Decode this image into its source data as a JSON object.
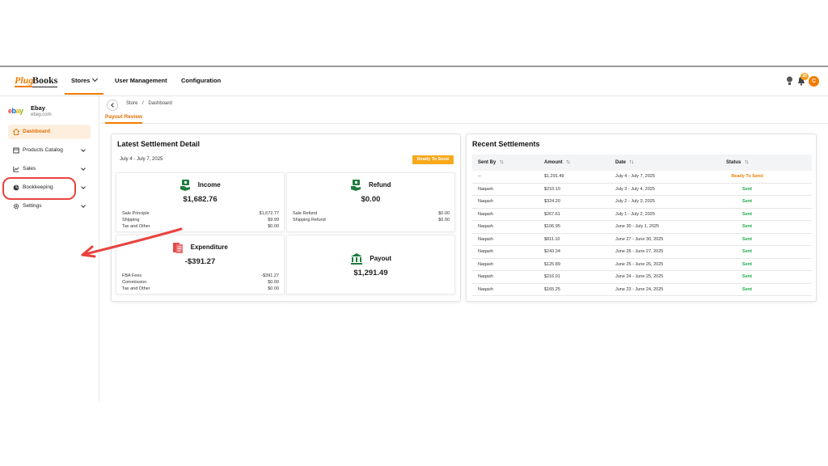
{
  "topnav": {
    "logo_plug": "Plug",
    "logo_books": "Books",
    "items": [
      {
        "label": "Stores"
      },
      {
        "label": "User Management"
      },
      {
        "label": "Configuration"
      }
    ],
    "notification_count": "20",
    "avatar_initial": "C",
    "accent_color": "#f07c00"
  },
  "sidebar": {
    "store_name": "Ebay",
    "store_domain": "ebay.com",
    "items": [
      {
        "label": "Dashboard",
        "icon": "home-icon",
        "active": true
      },
      {
        "label": "Products Catalog",
        "icon": "catalog-icon"
      },
      {
        "label": "Sales",
        "icon": "chart-icon"
      },
      {
        "label": "Bookkeeping",
        "icon": "bookkeeping-icon"
      },
      {
        "label": "Settings",
        "icon": "gear-icon"
      }
    ]
  },
  "breadcrumb": {
    "items": [
      "Store",
      "/",
      "Dashboard"
    ],
    "subtab": "Payout Review"
  },
  "latest": {
    "title": "Latest Settlement Detail",
    "period": "July 4 - July 7, 2025",
    "status_badge": "Ready To Send",
    "income": {
      "title": "Income",
      "amount": "$1,682.76",
      "lines": [
        {
          "label": "Sale Principle",
          "value": "$1,672.77"
        },
        {
          "label": "Shipping",
          "value": "$9.99"
        },
        {
          "label": "Tax and Other",
          "value": "$0.00"
        }
      ]
    },
    "refund": {
      "title": "Refund",
      "amount": "$0.00",
      "lines": [
        {
          "label": "Sale Refund",
          "value": "$0.00"
        },
        {
          "label": "Shipping Refund",
          "value": "$0.00"
        }
      ]
    },
    "expenditure": {
      "title": "Expenditure",
      "amount": "-$391.27",
      "lines": [
        {
          "label": "FBA Fees",
          "value": "-$391.27"
        },
        {
          "label": "Commission",
          "value": "$0.00"
        },
        {
          "label": "Tax and Other",
          "value": "$0.00"
        }
      ]
    },
    "payout": {
      "title": "Payout",
      "amount": "$1,291.49"
    }
  },
  "recent": {
    "title": "Recent Settlements",
    "columns": [
      "Sent By",
      "Amount",
      "Date",
      "Status"
    ],
    "rows": [
      {
        "sent_by": "--",
        "amount": "$1,291.49",
        "date": "July 4 - July 7, 2025",
        "status": "Ready To Send"
      },
      {
        "sent_by": "Naqash",
        "amount": "$210.10",
        "date": "July 3 - July 4, 2025",
        "status": "Sent"
      },
      {
        "sent_by": "Naqash",
        "amount": "$324.20",
        "date": "July 2 - July 3, 2025",
        "status": "Sent"
      },
      {
        "sent_by": "Naqash",
        "amount": "$267.61",
        "date": "July 1 - July 2, 2025",
        "status": "Sent"
      },
      {
        "sent_by": "Naqash",
        "amount": "$106.95",
        "date": "June 30 - July 1, 2025",
        "status": "Sent"
      },
      {
        "sent_by": "Naqash",
        "amount": "$811.10",
        "date": "June 27 - June 30, 2025",
        "status": "Sent"
      },
      {
        "sent_by": "Naqash",
        "amount": "$243.34",
        "date": "June 26 - June 27, 2025",
        "status": "Sent"
      },
      {
        "sent_by": "Naqash",
        "amount": "$125.89",
        "date": "June 25 - June 26, 2025",
        "status": "Sent"
      },
      {
        "sent_by": "Naqash",
        "amount": "$216.91",
        "date": "June 24 - June 25, 2025",
        "status": "Sent"
      },
      {
        "sent_by": "Naqash",
        "amount": "$165.25",
        "date": "June 23 - June 24, 2025",
        "status": "Sent"
      }
    ],
    "status_colors": {
      "ready": "#ef7d00",
      "sent": "#1ea94a"
    }
  }
}
